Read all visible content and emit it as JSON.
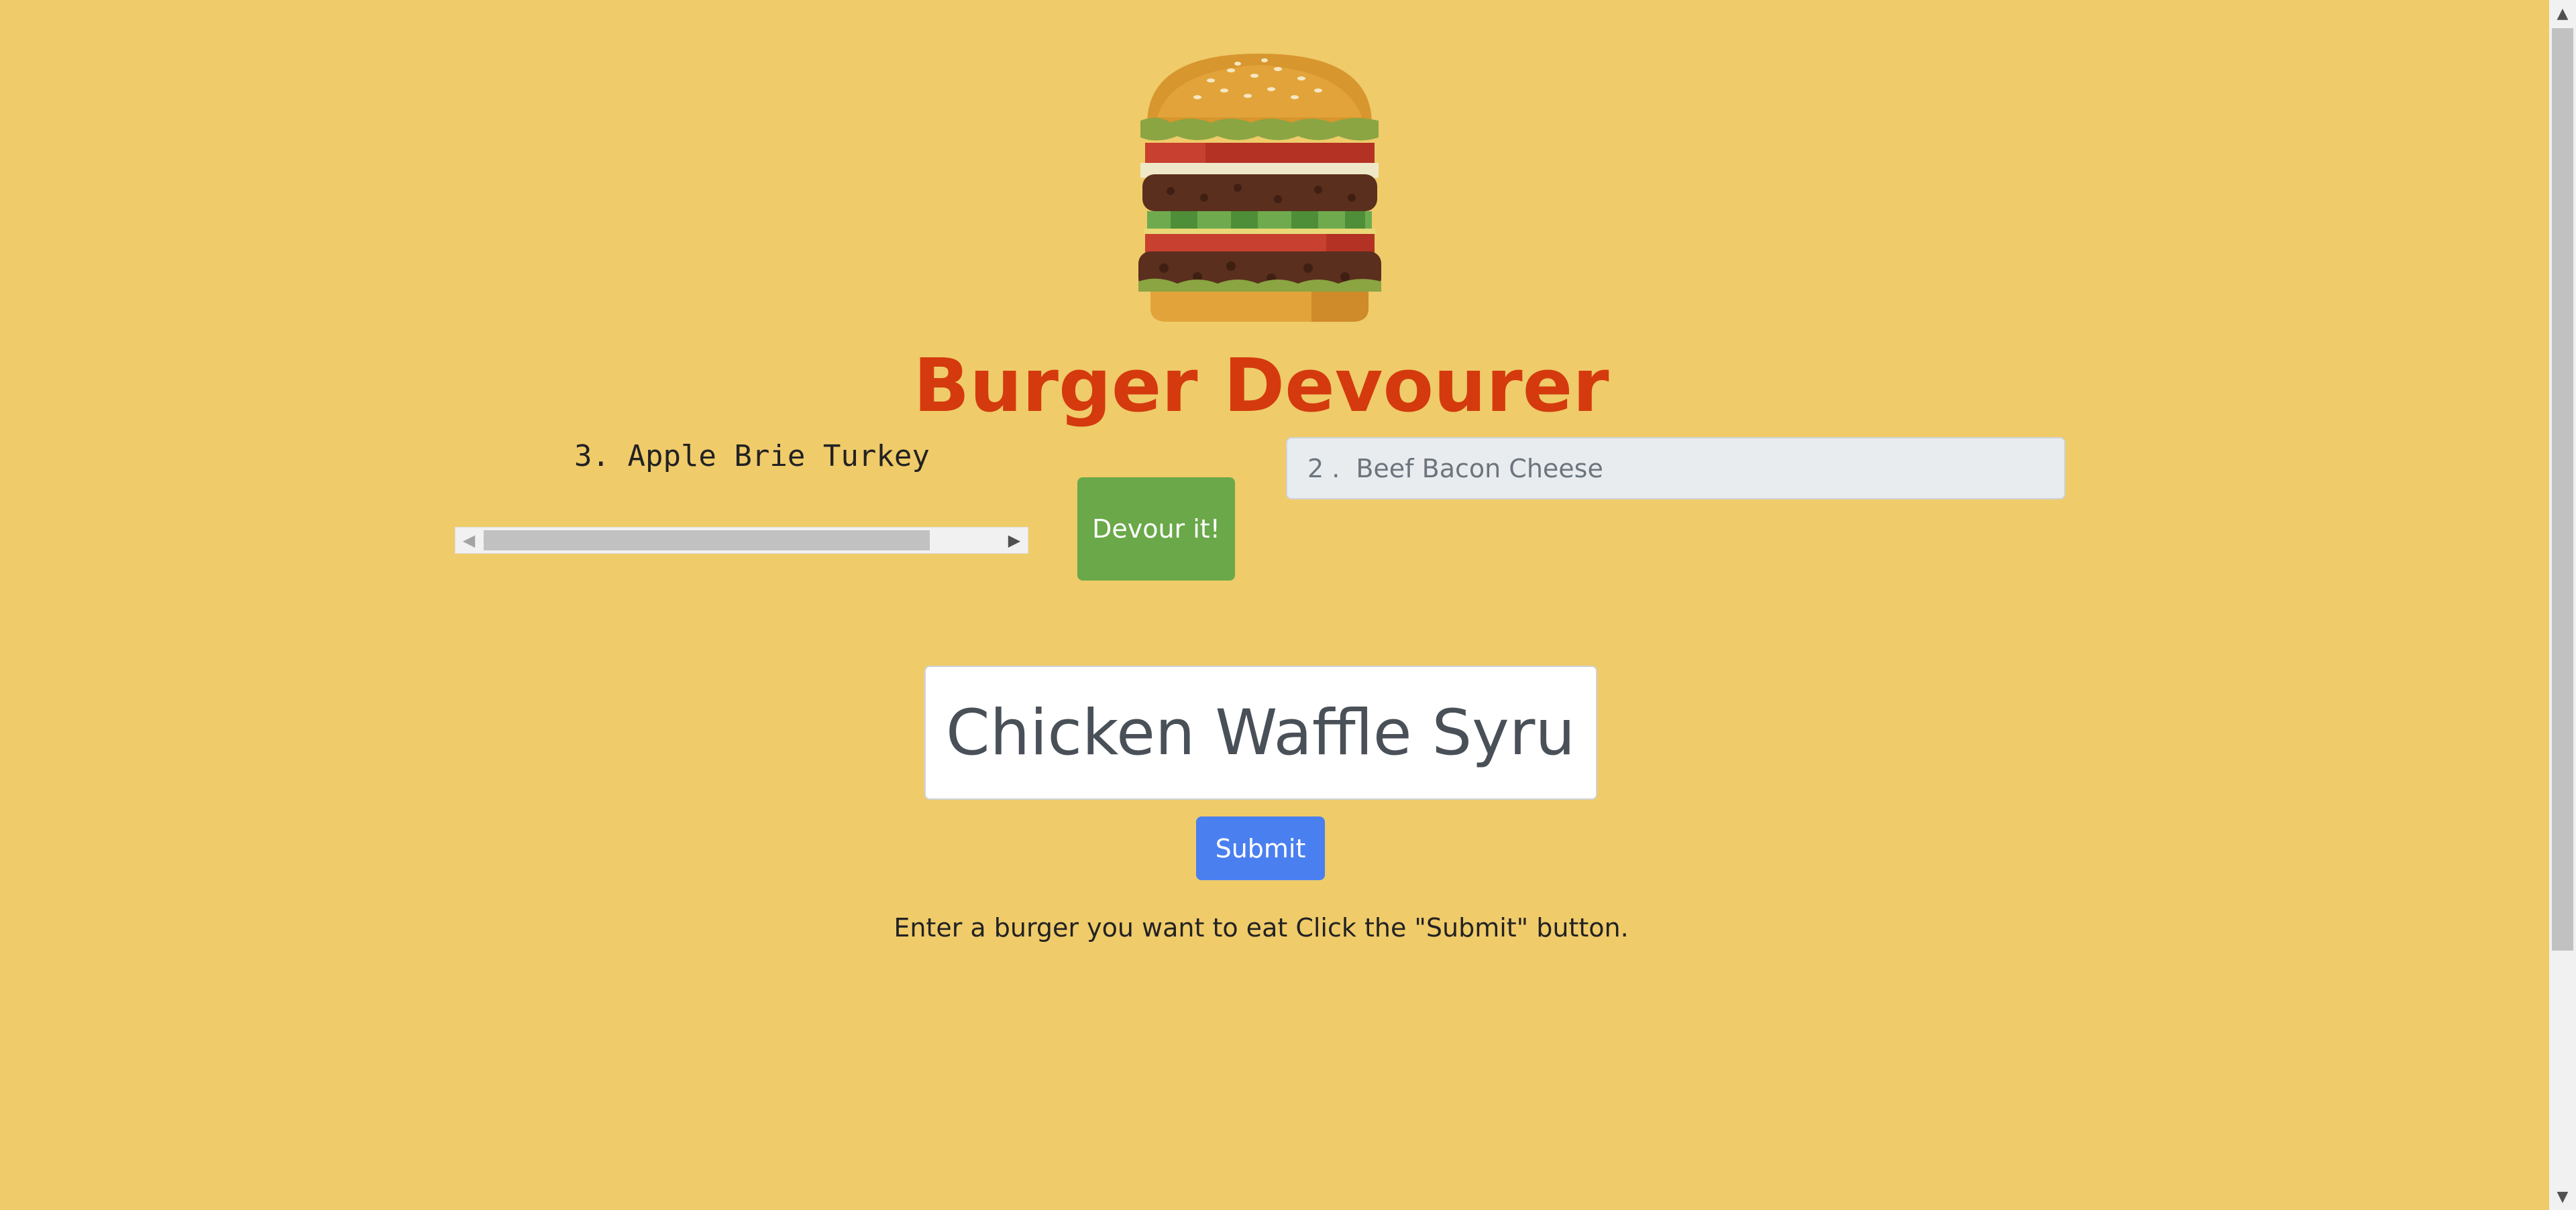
{
  "header": {
    "logo_icon": "burger-icon",
    "title": "Burger Devourer"
  },
  "devoured": {
    "item_text": "3. Apple Brie Turkey",
    "scroll_position_fraction": 0.0
  },
  "devour_button": {
    "label": "Devour it!",
    "color": "#6aa84a"
  },
  "queued_burger": {
    "number": "2 .",
    "name": "Beef Bacon Cheese"
  },
  "burger_form": {
    "input_value": "Chicken Waffle Syrup",
    "submit_label": "Submit",
    "submit_color": "#4a7ff0"
  },
  "instructions": "Enter a burger you want to eat Click the \"Submit\" button.",
  "colors": {
    "background": "#efcb6a",
    "title": "#d43a0e"
  }
}
